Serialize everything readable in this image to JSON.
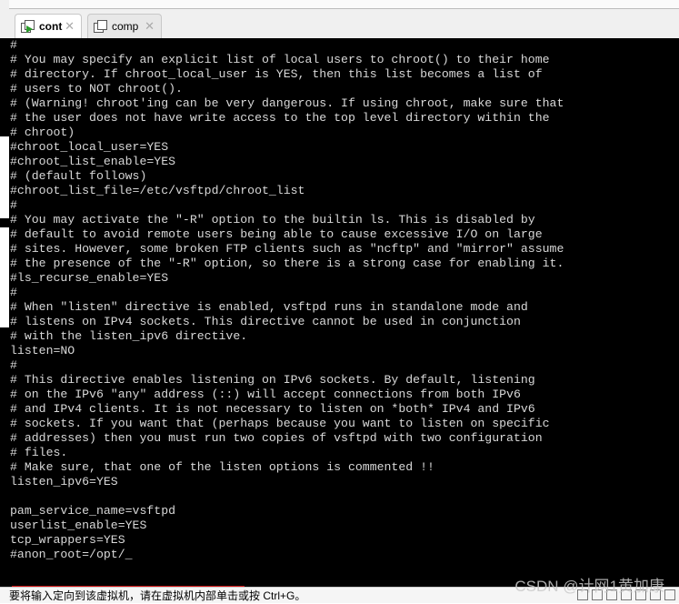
{
  "tabs": [
    {
      "label": "cont",
      "active": true
    },
    {
      "label": "comp",
      "active": false
    }
  ],
  "terminal": {
    "lines": [
      "#",
      "# You may specify an explicit list of local users to chroot() to their home",
      "# directory. If chroot_local_user is YES, then this list becomes a list of",
      "# users to NOT chroot().",
      "# (Warning! chroot'ing can be very dangerous. If using chroot, make sure that",
      "# the user does not have write access to the top level directory within the",
      "# chroot)",
      "#chroot_local_user=YES",
      "#chroot_list_enable=YES",
      "# (default follows)",
      "#chroot_list_file=/etc/vsftpd/chroot_list",
      "#",
      "# You may activate the \"-R\" option to the builtin ls. This is disabled by",
      "# default to avoid remote users being able to cause excessive I/O on large",
      "# sites. However, some broken FTP clients such as \"ncftp\" and \"mirror\" assume",
      "# the presence of the \"-R\" option, so there is a strong case for enabling it.",
      "#ls_recurse_enable=YES",
      "#",
      "# When \"listen\" directive is enabled, vsftpd runs in standalone mode and",
      "# listens on IPv4 sockets. This directive cannot be used in conjunction",
      "# with the listen_ipv6 directive.",
      "listen=NO",
      "#",
      "# This directive enables listening on IPv6 sockets. By default, listening",
      "# on the IPv6 \"any\" address (::) will accept connections from both IPv6",
      "# and IPv4 clients. It is not necessary to listen on *both* IPv4 and IPv6",
      "# sockets. If you want that (perhaps because you want to listen on specific",
      "# addresses) then you must run two copies of vsftpd with two configuration",
      "# files.",
      "# Make sure, that one of the listen options is commented !!",
      "listen_ipv6=YES",
      "",
      "pam_service_name=vsftpd",
      "userlist_enable=YES",
      "tcp_wrappers=YES",
      "#anon_root=/opt/_"
    ]
  },
  "status_bar": {
    "text": "要将输入定向到该虚拟机，请在虚拟机内部单击或按 Ctrl+G。"
  },
  "watermark": "CSDN @计网1黄加康",
  "colors": {
    "terminal_bg": "#000000",
    "terminal_fg": "#d8d8d8",
    "highlight_box": "#d01010"
  }
}
